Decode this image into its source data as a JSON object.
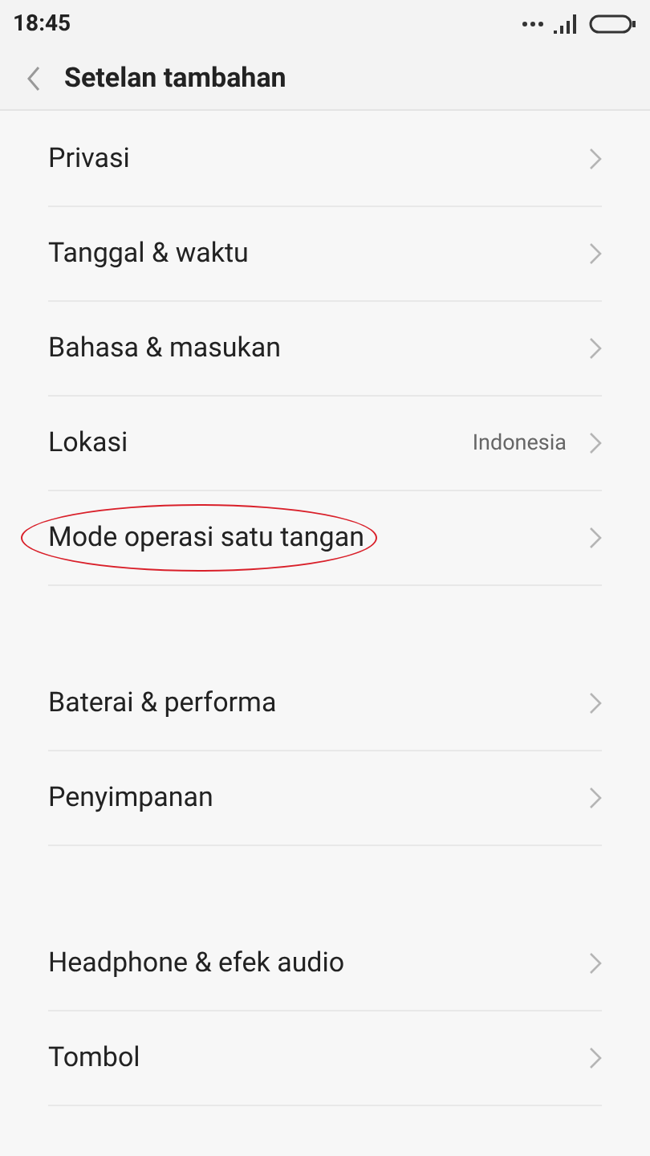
{
  "status_bar": {
    "time": "18:45"
  },
  "header": {
    "title": "Setelan tambahan"
  },
  "sections": [
    {
      "items": [
        {
          "label": "Privasi",
          "circled": false
        },
        {
          "label": "Tanggal & waktu",
          "circled": false
        },
        {
          "label": "Bahasa & masukan",
          "circled": false
        },
        {
          "label": "Lokasi",
          "value": "Indonesia",
          "circled": false
        },
        {
          "label": "Mode operasi satu tangan",
          "circled": true
        }
      ]
    },
    {
      "items": [
        {
          "label": "Baterai & performa",
          "circled": false
        },
        {
          "label": "Penyimpanan",
          "circled": false
        }
      ]
    },
    {
      "items": [
        {
          "label": "Headphone & efek audio",
          "circled": false
        },
        {
          "label": "Tombol",
          "circled": false
        }
      ]
    }
  ]
}
